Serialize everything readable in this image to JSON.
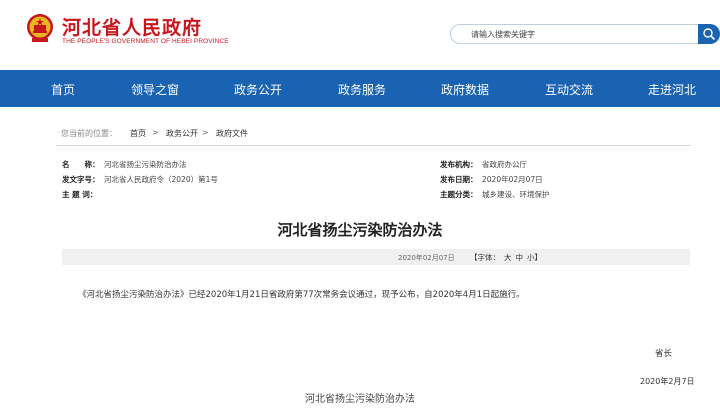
{
  "header": {
    "site_title": "河北省人民政府",
    "site_subtitle": "THE PEOPLE'S GOVERNMENT OF HEBEI PROVINCE",
    "brand_color": "#c8161d",
    "search_placeholder": "请输入搜索关键字",
    "search_icon": "search-icon"
  },
  "nav": {
    "color": "#1a62b2",
    "items": [
      "首页",
      "领导之窗",
      "政务公开",
      "政务服务",
      "政府数据",
      "互动交流",
      "走进河北"
    ]
  },
  "breadcrumb": {
    "label": "您当前的位置：",
    "items": [
      "首页",
      "政务公开",
      "政府文件"
    ],
    "separator": ">"
  },
  "meta": {
    "name_label": "名　　称：",
    "name_value": "河北省扬尘污染防治办法",
    "doc_no_label": "发文字号：",
    "doc_no_value": "河北省人民政府令（2020）第1号",
    "keywords_label": "主 题 词：",
    "keywords_value": "",
    "issuer_label": "发布机构：",
    "issuer_value": "省政府办公厅",
    "date_label": "发布日期：",
    "date_value": "2020年02月07日",
    "category_label": "主题分类：",
    "category_value": "城乡建设、环境保护"
  },
  "document": {
    "title": "河北省扬尘污染防治办法",
    "date": "2020年02月07日",
    "font_label": "【字体：",
    "font_large": "大",
    "font_medium": "中",
    "font_small": "小",
    "font_close": "】",
    "paragraph": "《河北省扬尘污染防治办法》已经2020年1月21日省政府第77次常务会议通过，现予公布，自2020年4月1日起施行。",
    "signature_role": "省长",
    "signature_date": "2020年2月7日",
    "attachment_title": "河北省扬尘污染防治办法"
  }
}
